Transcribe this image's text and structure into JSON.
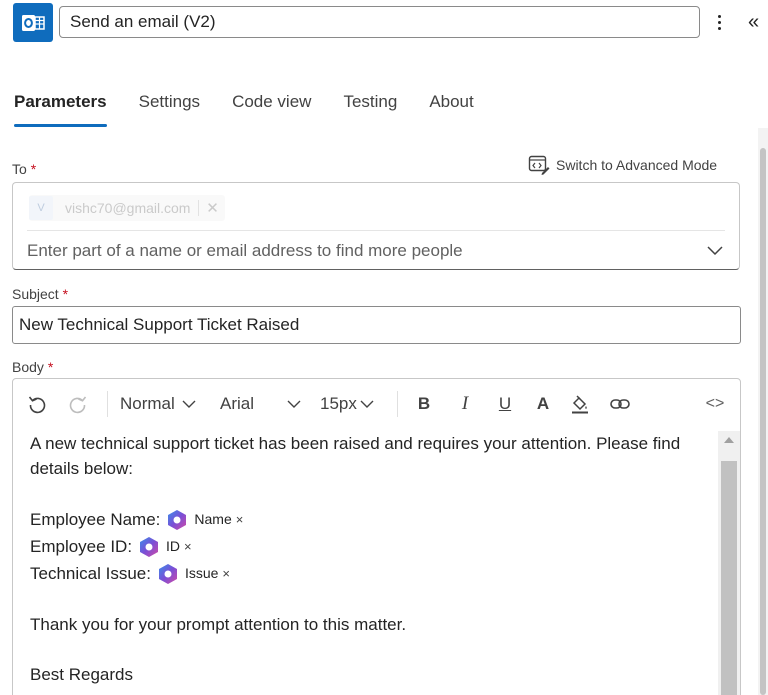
{
  "header": {
    "action_title": "Send an email (V2)",
    "app_icon": "outlook-icon",
    "more_icon": "more-vertical-icon",
    "collapse_icon": "double-chevron-left-icon",
    "collapse_glyph": "«"
  },
  "tabs": [
    {
      "label": "Parameters",
      "active": true
    },
    {
      "label": "Settings",
      "active": false
    },
    {
      "label": "Code view",
      "active": false
    },
    {
      "label": "Testing",
      "active": false
    },
    {
      "label": "About",
      "active": false
    }
  ],
  "to": {
    "label": "To",
    "required_mark": "*",
    "advanced_mode_label": "Switch to Advanced Mode",
    "chip": {
      "initial": "V",
      "email": "vishc70@gmail.com",
      "remove_glyph": "✕"
    },
    "placeholder": "Enter part of a name or email address to find more people"
  },
  "subject": {
    "label": "Subject",
    "required_mark": "*",
    "value": "New Technical Support Ticket Raised"
  },
  "body": {
    "label": "Body",
    "required_mark": "*",
    "toolbar": {
      "style": "Normal",
      "font": "Arial",
      "size": "15px",
      "bold": "B",
      "italic": "I",
      "underline": "U",
      "font_color": "A",
      "code_view": "<>"
    },
    "intro": "A new technical support ticket has been raised and requires your attention. Please find details below:",
    "fields": [
      {
        "label": "Employee Name:",
        "token": "Name",
        "remove": "×"
      },
      {
        "label": "Employee ID:",
        "token": "ID",
        "remove": "×"
      },
      {
        "label": "Technical Issue:",
        "token": "Issue",
        "remove": "×"
      }
    ],
    "thanks": "Thank you for your prompt attention to this matter.",
    "closing": "Best Regards"
  },
  "colors": {
    "accent": "#0f6cbd",
    "required": "#c50f1f"
  }
}
